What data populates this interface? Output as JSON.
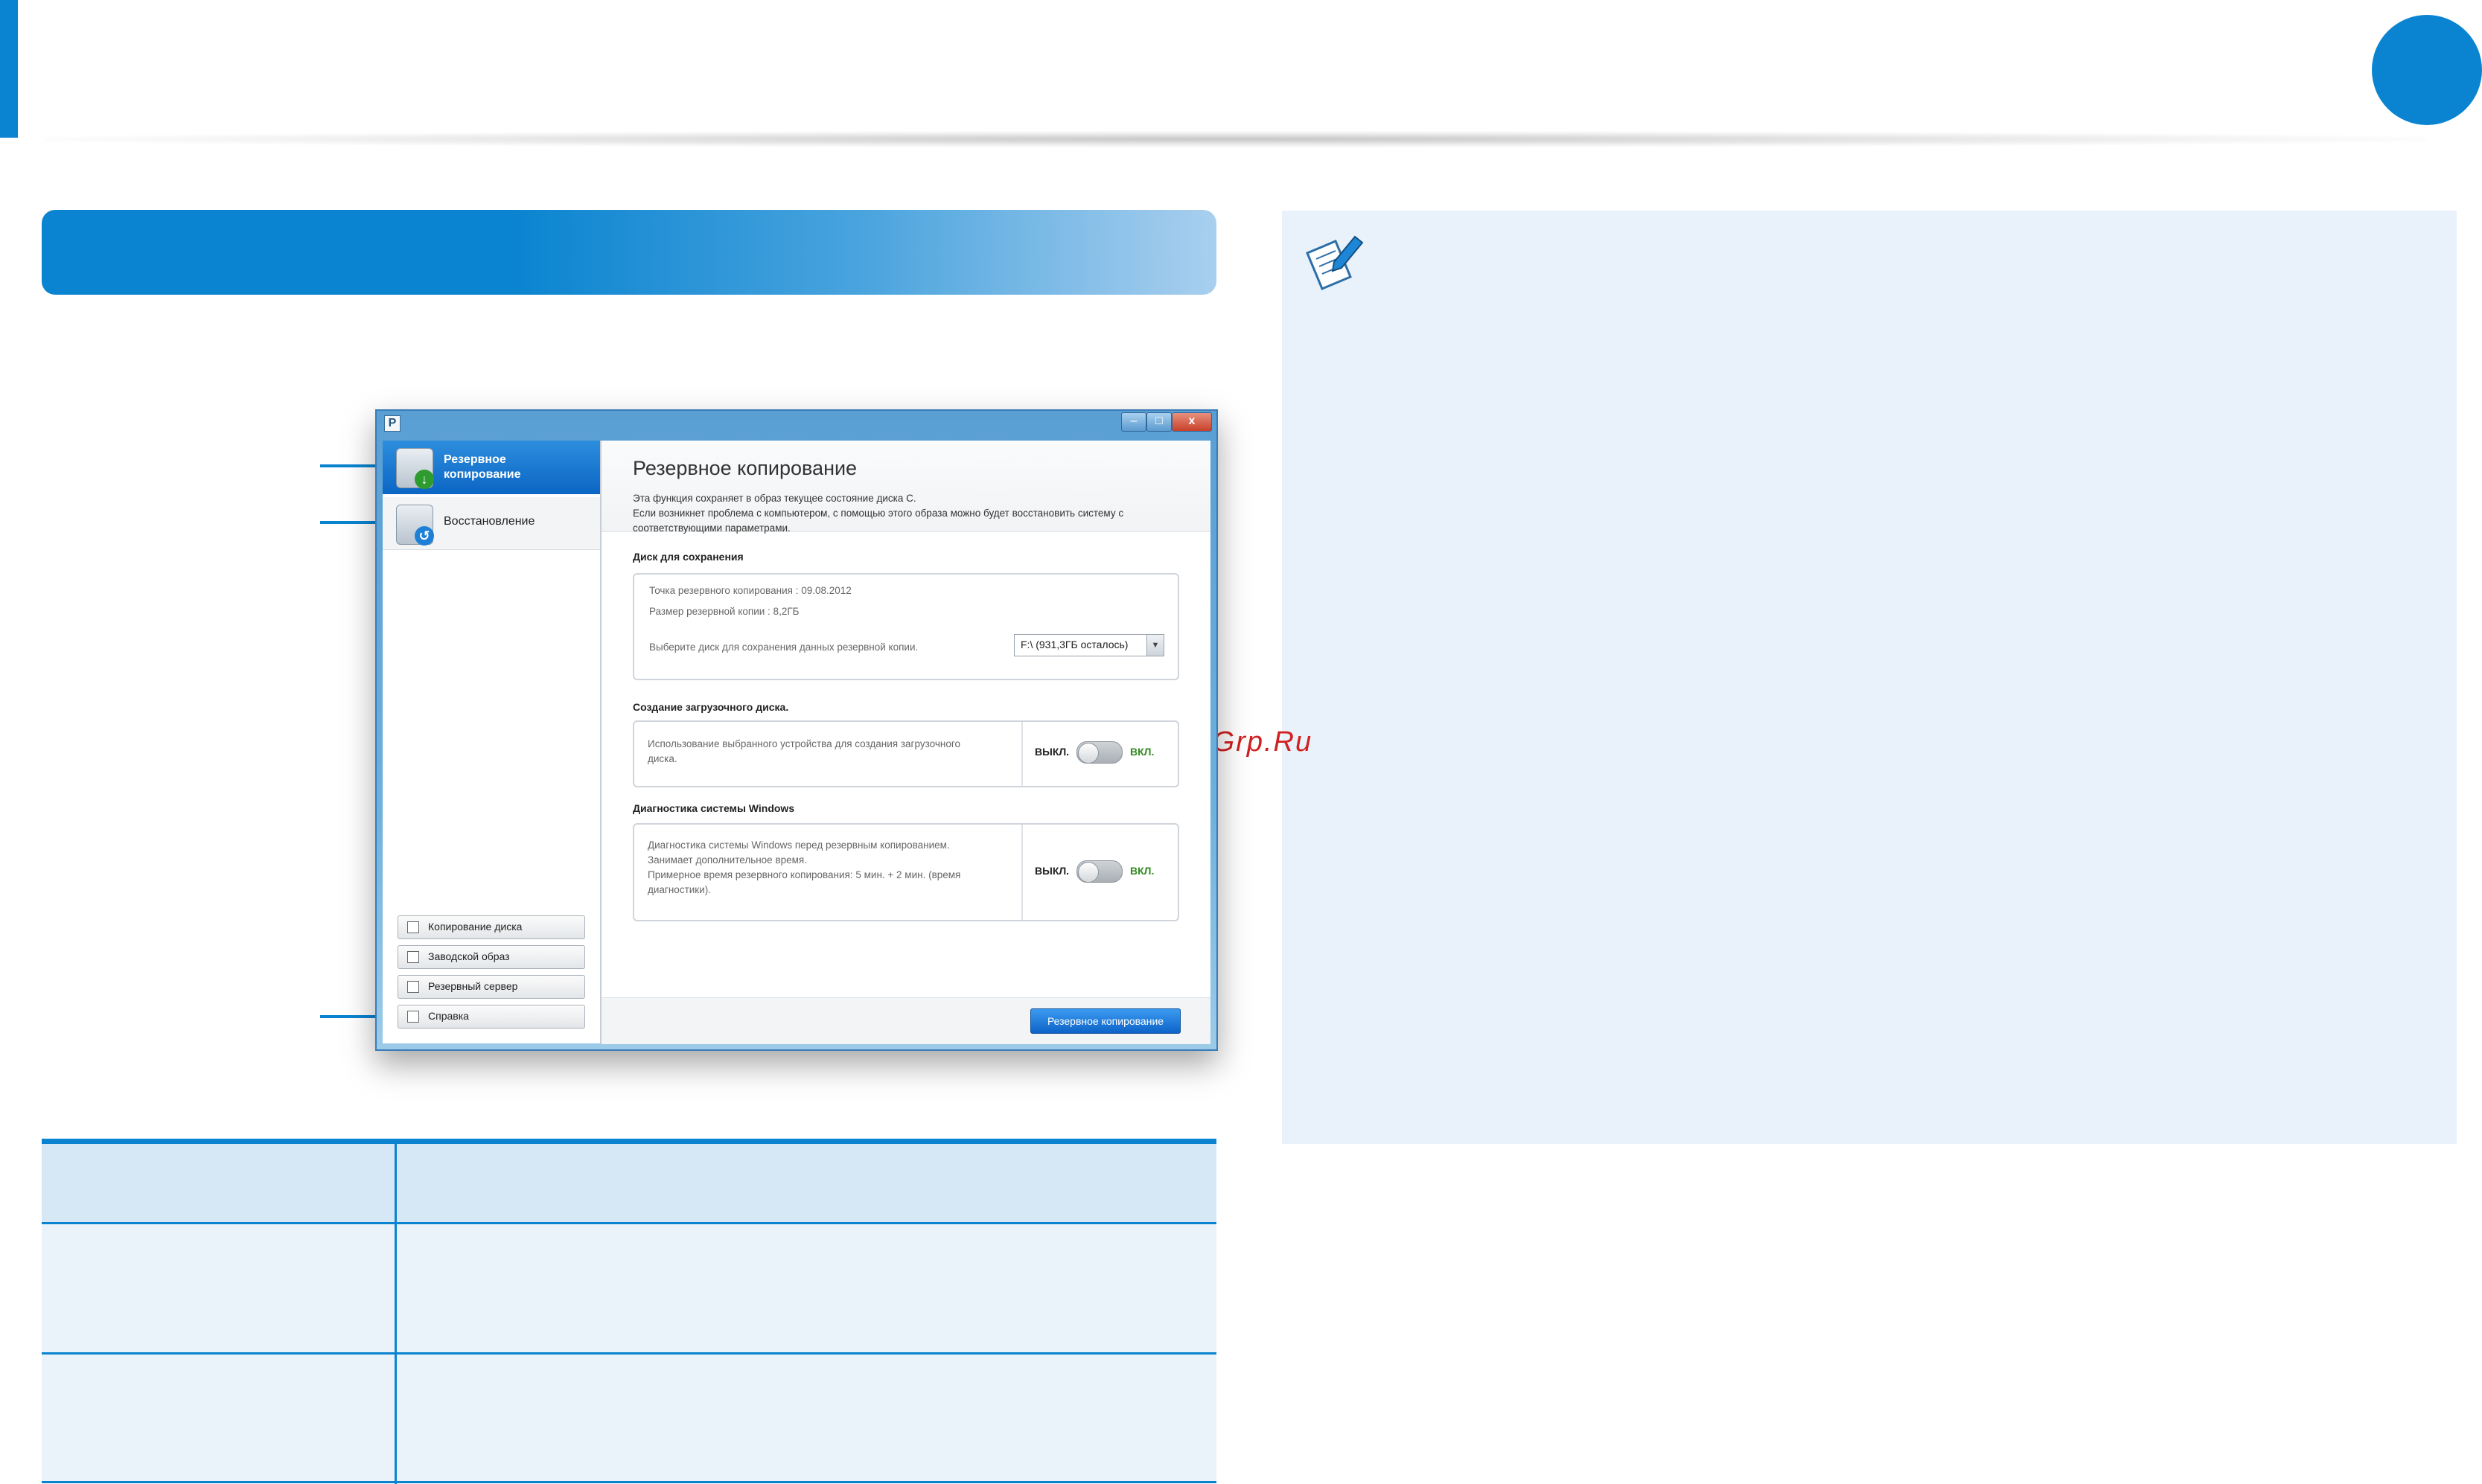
{
  "app_window": {
    "app_icon": "P",
    "controls": {
      "minimize": "–",
      "maximize": "□",
      "close": "x"
    },
    "sidebar": {
      "nav_items": [
        {
          "label": "Резервное копирование",
          "icon": "backup-icon",
          "active": true
        },
        {
          "label": "Восстановление",
          "icon": "restore-icon",
          "active": false
        }
      ],
      "buttons": [
        {
          "label": "Копирование диска",
          "icon": "disk-copy-icon"
        },
        {
          "label": "Заводской образ",
          "icon": "factory-image-icon"
        },
        {
          "label": "Резервный сервер",
          "icon": "server-icon"
        },
        {
          "label": "Справка",
          "icon": "help-icon"
        }
      ]
    },
    "main": {
      "title": "Резервное копирование",
      "description_line1": "Эта функция сохраняет в образ текущее состояние диска C.",
      "description_line2": "Если возникнет проблема с компьютером, с помощью этого образа можно будет восстановить систему с соответствующими параметрами.",
      "disk_section": {
        "heading": "Диск для сохранения",
        "backup_point": "Точка резервного копирования : 09.08.2012",
        "backup_size": "Размер резервной копии : 8,2ГБ",
        "select_prompt": "Выберите диск для сохранения данных резервной копии.",
        "select_value": "F:\\ (931,3ГБ осталось)"
      },
      "boot_section": {
        "heading": "Создание загрузочного диска.",
        "text_line1": "Использование выбранного устройства для создания загрузочного",
        "text_line2": "диска.",
        "off_label": "ВЫКЛ.",
        "on_label": "ВКЛ.",
        "state": "off"
      },
      "diag_section": {
        "heading": "Диагностика системы Windows",
        "text_line1": "Диагностика системы Windows перед резервным копированием.",
        "text_line2": "Занимает дополнительное время.",
        "text_line3": "Примерное время резервного копирования: 5 мин. + 2 мин. (время",
        "text_line4": "диагностики).",
        "off_label": "ВЫКЛ.",
        "on_label": "ВКЛ.",
        "state": "off"
      },
      "primary_button": "Резервное копирование"
    }
  },
  "watermark": "McGrp.Ru",
  "icons": {
    "note": "note-pencil-icon"
  },
  "colors": {
    "accent": "#0a84d0",
    "note_bg": "#e9f2fb",
    "table_head": "#d6e7f6"
  }
}
